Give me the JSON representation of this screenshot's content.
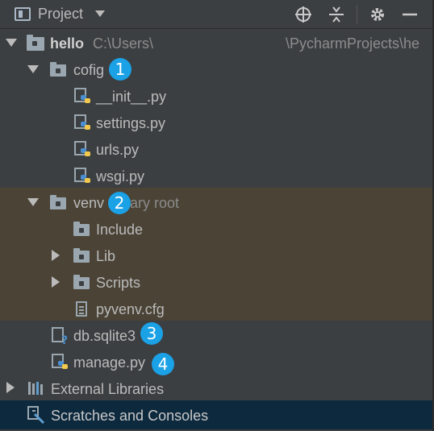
{
  "header": {
    "title": "Project",
    "icons": [
      "locate-icon",
      "collapse-all-icon",
      "gear-icon",
      "minimize-icon"
    ]
  },
  "tree": {
    "root": {
      "name": "hello",
      "path": "C:\\Users\\",
      "path_tail": "\\PycharmProjects\\he"
    },
    "cofig": {
      "name": "cofig",
      "badge": "1"
    },
    "files_cofig": [
      "__init__.py",
      "settings.py",
      "urls.py",
      "wsgi.py"
    ],
    "venv": {
      "name": "venv",
      "suffix": "library root",
      "badge": "2"
    },
    "venv_children": [
      "Include",
      "Lib",
      "Scripts",
      "pyvenv.cfg"
    ],
    "db": {
      "name": "db.sqlite3",
      "badge": "3"
    },
    "manage": {
      "name": "manage.py",
      "badge": "4"
    },
    "external": "External Libraries",
    "scratches": "Scratches and Consoles"
  },
  "colors": {
    "background": "#3c3f41",
    "venv_highlight": "#4a4336",
    "selection": "#0d293e",
    "badge": "#1aa1e6"
  }
}
